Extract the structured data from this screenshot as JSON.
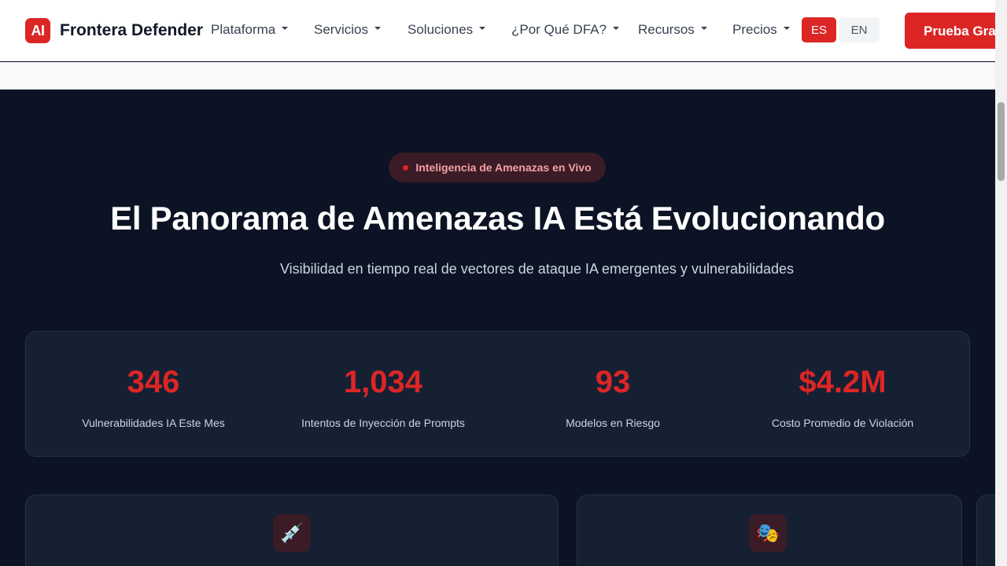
{
  "brand": {
    "logo_text": "AI",
    "name": "Frontera Defender"
  },
  "nav": [
    {
      "label": "Plataforma"
    },
    {
      "label": "Servicios"
    },
    {
      "label": "Soluciones"
    },
    {
      "label": "¿Por Qué DFA?"
    },
    {
      "label": "Recursos"
    },
    {
      "label": "Precios"
    }
  ],
  "lang": {
    "es": "ES",
    "en": "EN"
  },
  "cta": {
    "label": "Prueba Gratis"
  },
  "hero": {
    "badge": "Inteligencia de Amenazas en Vivo",
    "title": "El Panorama de Amenazas IA Está Evolucionando",
    "subtitle": "Visibilidad en tiempo real de vectores de ataque IA emergentes y vulnerabilidades"
  },
  "stats": [
    {
      "value": "346",
      "label": "Vulnerabilidades IA Este Mes"
    },
    {
      "value": "1,034",
      "label": "Intentos de Inyección de Prompts"
    },
    {
      "value": "93",
      "label": "Modelos en Riesgo"
    },
    {
      "value": "$4.2M",
      "label": "Costo Promedio de Violación"
    }
  ],
  "cards": [
    {
      "icon": "syringe-icon",
      "glyph": "💉"
    },
    {
      "icon": "theater-masks-icon",
      "glyph": "🎭"
    }
  ],
  "colors": {
    "accent": "#dc2626",
    "background": "#0b1324",
    "panel": "#152033"
  }
}
